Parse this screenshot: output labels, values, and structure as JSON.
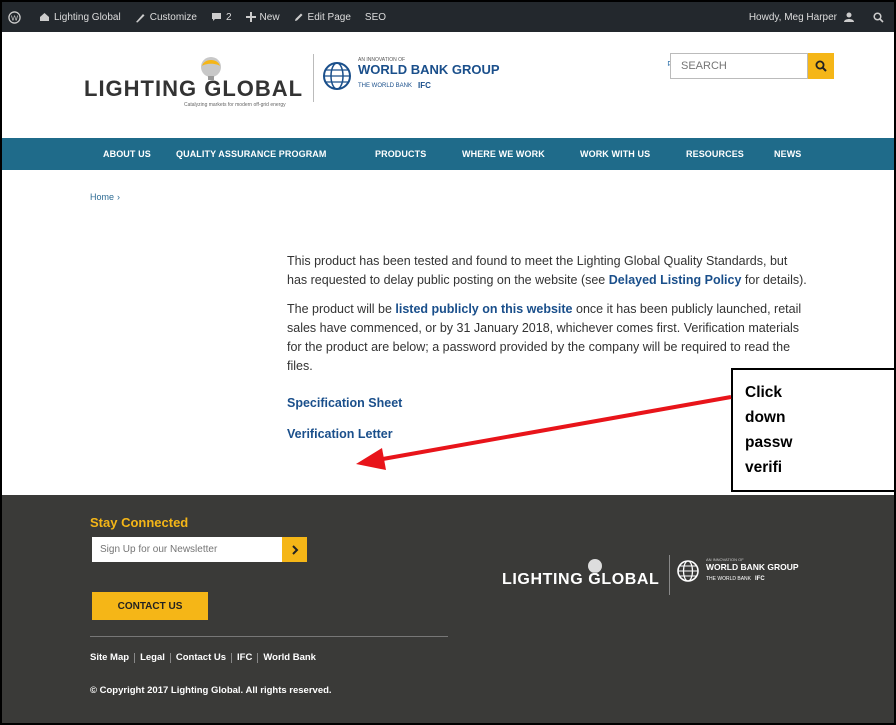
{
  "admin_bar": {
    "site_name": "Lighting Global",
    "customize": "Customize",
    "comments_count": "2",
    "new_label": "New",
    "edit_page": "Edit Page",
    "seo": "SEO",
    "howdy": "Howdy, Meg Harper"
  },
  "header": {
    "logo_text": "LIGHTING GLOBAL",
    "logo_tagline": "Catalyzing markets for modern off-grid energy",
    "partner_small": "AN INNOVATION OF",
    "partner_name": "WORLD BANK GROUP",
    "partner_sub1": "THE WORLD BANK",
    "partner_sub2": "IFC",
    "language": "中文",
    "search_placeholder": "SEARCH"
  },
  "nav": {
    "items": [
      {
        "label": "ABOUT US"
      },
      {
        "label": "QUALITY ASSURANCE PROGRAM"
      },
      {
        "label": "PRODUCTS"
      },
      {
        "label": "WHERE WE WORK"
      },
      {
        "label": "WORK WITH US"
      },
      {
        "label": "RESOURCES"
      },
      {
        "label": "NEWS"
      }
    ]
  },
  "breadcrumb": {
    "home": "Home",
    "separator": "›"
  },
  "content": {
    "p1_text_a": "This product has been tested and found to meet the Lighting Global Quality Standards, but has requested to delay public posting on the website (see ",
    "p1_link": "Delayed Listing Policy",
    "p1_text_b": " for details).",
    "p2_text_a": "The product will be ",
    "p2_link": "listed publicly on this website",
    "p2_text_b": " once it has been publicly launched, retail sales have commenced, or by 31 January 2018, whichever comes first. Verification materials for the product are below; a password provided by the company will be required to read the files.",
    "spec_sheet": "Specification Sheet",
    "verification_letter": "Verification Letter"
  },
  "callout": {
    "line1": "Click",
    "line2": "down",
    "line3": "passw",
    "line4": "verifi"
  },
  "footer": {
    "stay_connected": "Stay Connected",
    "newsletter_placeholder": "Sign Up for our Newsletter",
    "contact_button": "CONTACT US",
    "links": [
      "Site Map",
      "Legal",
      "Contact Us",
      "IFC",
      "World Bank"
    ],
    "copyright": "© Copyright 2017 Lighting Global. All rights reserved.",
    "logo_text": "LIGHTING GLOBAL",
    "partner_small": "AN INNOVATION OF",
    "partner_name": "WORLD BANK GROUP",
    "partner_sub1": "THE WORLD BANK",
    "partner_sub2": "IFC"
  },
  "colors": {
    "admin_bar": "#23282d",
    "nav": "#1f6b8a",
    "accent": "#f5b617",
    "link": "#1a4f8b",
    "footer": "#3a3a38",
    "arrow": "#e8141a"
  }
}
